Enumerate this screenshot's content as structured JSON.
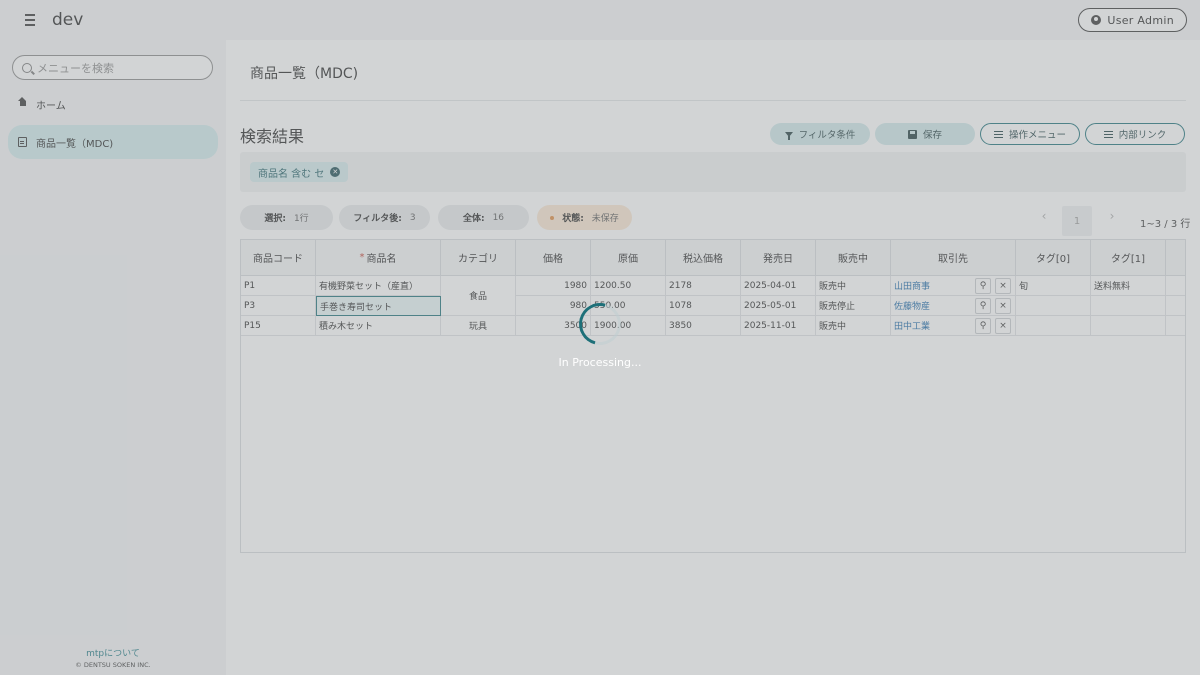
{
  "app": {
    "title": "dev",
    "user_label": "User Admin"
  },
  "sidebar": {
    "search_placeholder": "メニューを検索",
    "items": [
      {
        "label": "ホーム",
        "icon": "home-icon",
        "active": false
      },
      {
        "label": "商品一覧（MDC)",
        "icon": "document-icon",
        "active": true
      }
    ],
    "about_link": "mtpについて",
    "copyright": "© DENTSU SOKEN INC."
  },
  "main": {
    "page_title": "商品一覧（MDC)",
    "section_title": "検索結果",
    "toolbar": {
      "filter": "フィルタ条件",
      "save": "保存",
      "ops_menu": "操作メニュー",
      "internal_link": "内部リンク"
    },
    "filter_chip": "商品名 含む セ",
    "stats": {
      "selected_key": "選択:",
      "selected_val": "1行",
      "filtered_key": "フィルタ後:",
      "filtered_val": "3",
      "total_key": "全体:",
      "total_val": "16",
      "status_key": "状態:",
      "status_val": "未保存"
    },
    "pager": {
      "prev": "‹",
      "page": "1",
      "next": "›",
      "info": "1~3 / 3 行"
    }
  },
  "grid": {
    "columns": [
      "商品コード",
      "商品名",
      "カテゴリ",
      "価格",
      "原価",
      "税込価格",
      "発売日",
      "販売中",
      "取引先",
      "タグ[0]",
      "タグ[1]"
    ],
    "required_column": "商品名",
    "rows": [
      {
        "code": "P1",
        "name": "有機野菜セット（産直）",
        "category": "食品",
        "price": "1980",
        "cost": "1200.50",
        "tax_price": "2178",
        "date": "2025-04-01",
        "sale": "販売中",
        "partner": "山田商事",
        "tag0": "旬",
        "tag1": "送料無料"
      },
      {
        "code": "P3",
        "name": "手巻き寿司セット",
        "category": "食品",
        "price": "980",
        "cost": "550.00",
        "tax_price": "1078",
        "date": "2025-05-01",
        "sale": "販売停止",
        "partner": "佐藤物産",
        "tag0": "",
        "tag1": ""
      },
      {
        "code": "P15",
        "name": "積み木セット",
        "category": "玩具",
        "price": "3500",
        "cost": "1900.00",
        "tax_price": "3850",
        "date": "2025-11-01",
        "sale": "販売中",
        "partner": "田中工業",
        "tag0": "",
        "tag1": ""
      }
    ],
    "cell_search_glyph": "🔍",
    "cell_clear_glyph": "×"
  },
  "overlay": {
    "message": "In Processing..."
  },
  "colors": {
    "accent": "#1a6f78",
    "chip_bg": "#d5ecee",
    "active_nav": "#d1ecee",
    "warn_bg": "#fbe7d2",
    "link": "#1565a8"
  }
}
